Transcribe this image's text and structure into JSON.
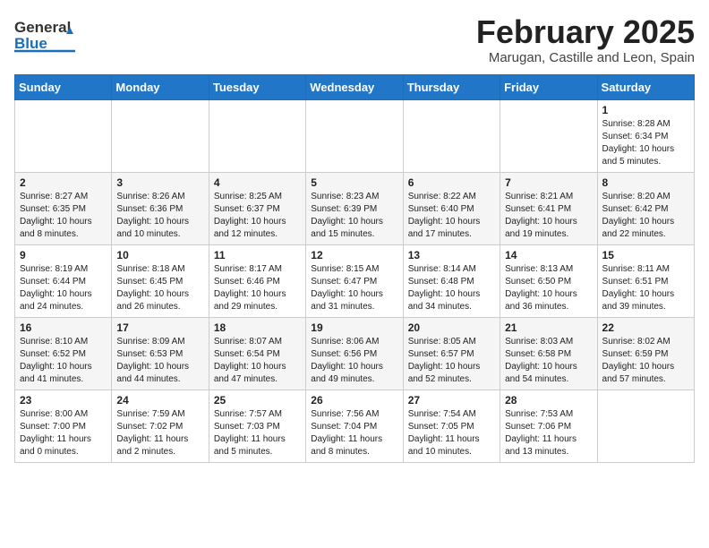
{
  "header": {
    "logo_general": "General",
    "logo_blue": "Blue",
    "month_title": "February 2025",
    "location": "Marugan, Castille and Leon, Spain"
  },
  "weekdays": [
    "Sunday",
    "Monday",
    "Tuesday",
    "Wednesday",
    "Thursday",
    "Friday",
    "Saturday"
  ],
  "weeks": [
    [
      {
        "day": "",
        "info": ""
      },
      {
        "day": "",
        "info": ""
      },
      {
        "day": "",
        "info": ""
      },
      {
        "day": "",
        "info": ""
      },
      {
        "day": "",
        "info": ""
      },
      {
        "day": "",
        "info": ""
      },
      {
        "day": "1",
        "info": "Sunrise: 8:28 AM\nSunset: 6:34 PM\nDaylight: 10 hours\nand 5 minutes."
      }
    ],
    [
      {
        "day": "2",
        "info": "Sunrise: 8:27 AM\nSunset: 6:35 PM\nDaylight: 10 hours\nand 8 minutes."
      },
      {
        "day": "3",
        "info": "Sunrise: 8:26 AM\nSunset: 6:36 PM\nDaylight: 10 hours\nand 10 minutes."
      },
      {
        "day": "4",
        "info": "Sunrise: 8:25 AM\nSunset: 6:37 PM\nDaylight: 10 hours\nand 12 minutes."
      },
      {
        "day": "5",
        "info": "Sunrise: 8:23 AM\nSunset: 6:39 PM\nDaylight: 10 hours\nand 15 minutes."
      },
      {
        "day": "6",
        "info": "Sunrise: 8:22 AM\nSunset: 6:40 PM\nDaylight: 10 hours\nand 17 minutes."
      },
      {
        "day": "7",
        "info": "Sunrise: 8:21 AM\nSunset: 6:41 PM\nDaylight: 10 hours\nand 19 minutes."
      },
      {
        "day": "8",
        "info": "Sunrise: 8:20 AM\nSunset: 6:42 PM\nDaylight: 10 hours\nand 22 minutes."
      }
    ],
    [
      {
        "day": "9",
        "info": "Sunrise: 8:19 AM\nSunset: 6:44 PM\nDaylight: 10 hours\nand 24 minutes."
      },
      {
        "day": "10",
        "info": "Sunrise: 8:18 AM\nSunset: 6:45 PM\nDaylight: 10 hours\nand 26 minutes."
      },
      {
        "day": "11",
        "info": "Sunrise: 8:17 AM\nSunset: 6:46 PM\nDaylight: 10 hours\nand 29 minutes."
      },
      {
        "day": "12",
        "info": "Sunrise: 8:15 AM\nSunset: 6:47 PM\nDaylight: 10 hours\nand 31 minutes."
      },
      {
        "day": "13",
        "info": "Sunrise: 8:14 AM\nSunset: 6:48 PM\nDaylight: 10 hours\nand 34 minutes."
      },
      {
        "day": "14",
        "info": "Sunrise: 8:13 AM\nSunset: 6:50 PM\nDaylight: 10 hours\nand 36 minutes."
      },
      {
        "day": "15",
        "info": "Sunrise: 8:11 AM\nSunset: 6:51 PM\nDaylight: 10 hours\nand 39 minutes."
      }
    ],
    [
      {
        "day": "16",
        "info": "Sunrise: 8:10 AM\nSunset: 6:52 PM\nDaylight: 10 hours\nand 41 minutes."
      },
      {
        "day": "17",
        "info": "Sunrise: 8:09 AM\nSunset: 6:53 PM\nDaylight: 10 hours\nand 44 minutes."
      },
      {
        "day": "18",
        "info": "Sunrise: 8:07 AM\nSunset: 6:54 PM\nDaylight: 10 hours\nand 47 minutes."
      },
      {
        "day": "19",
        "info": "Sunrise: 8:06 AM\nSunset: 6:56 PM\nDaylight: 10 hours\nand 49 minutes."
      },
      {
        "day": "20",
        "info": "Sunrise: 8:05 AM\nSunset: 6:57 PM\nDaylight: 10 hours\nand 52 minutes."
      },
      {
        "day": "21",
        "info": "Sunrise: 8:03 AM\nSunset: 6:58 PM\nDaylight: 10 hours\nand 54 minutes."
      },
      {
        "day": "22",
        "info": "Sunrise: 8:02 AM\nSunset: 6:59 PM\nDaylight: 10 hours\nand 57 minutes."
      }
    ],
    [
      {
        "day": "23",
        "info": "Sunrise: 8:00 AM\nSunset: 7:00 PM\nDaylight: 11 hours\nand 0 minutes."
      },
      {
        "day": "24",
        "info": "Sunrise: 7:59 AM\nSunset: 7:02 PM\nDaylight: 11 hours\nand 2 minutes."
      },
      {
        "day": "25",
        "info": "Sunrise: 7:57 AM\nSunset: 7:03 PM\nDaylight: 11 hours\nand 5 minutes."
      },
      {
        "day": "26",
        "info": "Sunrise: 7:56 AM\nSunset: 7:04 PM\nDaylight: 11 hours\nand 8 minutes."
      },
      {
        "day": "27",
        "info": "Sunrise: 7:54 AM\nSunset: 7:05 PM\nDaylight: 11 hours\nand 10 minutes."
      },
      {
        "day": "28",
        "info": "Sunrise: 7:53 AM\nSunset: 7:06 PM\nDaylight: 11 hours\nand 13 minutes."
      },
      {
        "day": "",
        "info": ""
      }
    ]
  ]
}
